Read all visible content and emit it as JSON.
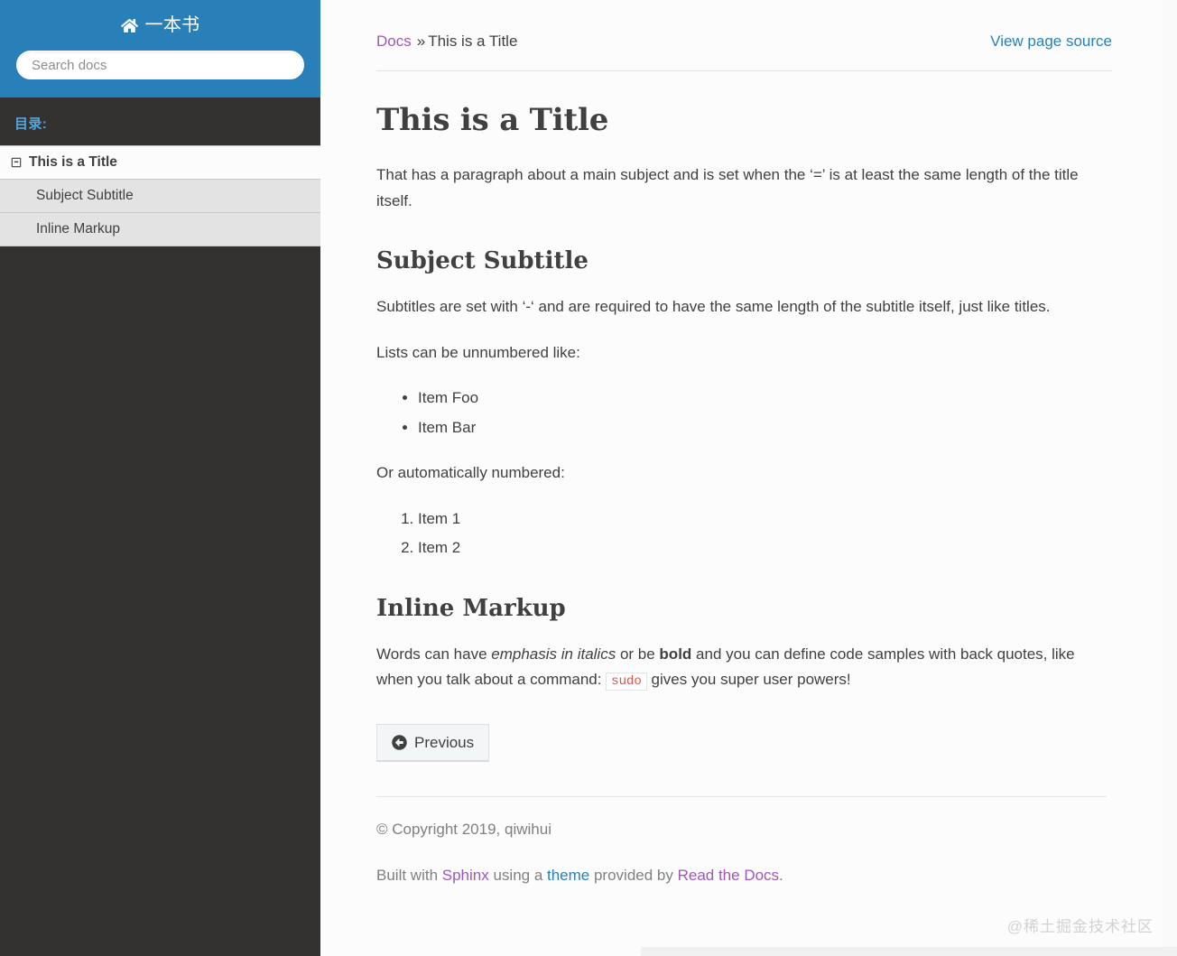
{
  "sidebar": {
    "brand": {
      "icon": "home-icon",
      "label": "一本书"
    },
    "search": {
      "placeholder": "Search docs",
      "value": ""
    },
    "caption": "目录:",
    "current_item": {
      "label": "This is a Title",
      "toggle_icon": "minus-square-icon"
    },
    "sub_items": [
      {
        "label": "Subject Subtitle"
      },
      {
        "label": "Inline Markup"
      }
    ],
    "colors": {
      "header_bg": "#2980b9",
      "nav_bg": "#343131",
      "current_bg": "#fcfcfc",
      "sub_bg": "#e3e3e3",
      "caption_color": "#55a5d9"
    }
  },
  "breadcrumb": {
    "root_label": "Docs",
    "separator": "»",
    "current_label": "This is a Title",
    "view_source_label": "View page source"
  },
  "document": {
    "h1": "This is a Title",
    "p_intro": "That has a paragraph about a main subject and is set when the ‘=’ is at least the same length of the title itself.",
    "h2_subject": "Subject Subtitle",
    "p_subtitles": "Subtitles are set with ‘-‘ and are required to have the same length of the subtitle itself, just like titles.",
    "p_unnumbered_intro": "Lists can be unnumbered like:",
    "bullet_items": [
      "Item Foo",
      "Item Bar"
    ],
    "p_numbered_intro": "Or automatically numbered:",
    "numbered_items": [
      "Item 1",
      "Item 2"
    ],
    "h2_inline": "Inline Markup",
    "inline_paragraph": {
      "part1": "Words can have ",
      "emphasis": "emphasis in italics",
      "part2": " or be ",
      "bold": "bold",
      "part3": " and you can define code samples with back quotes, like when you talk about a command: ",
      "code": "sudo",
      "part4": " gives you super user powers!"
    }
  },
  "nav_buttons": {
    "previous_label": "Previous",
    "previous_icon": "arrow-left-circle-icon"
  },
  "footer": {
    "copyright": "© Copyright 2019, qiwihui",
    "built_with_prefix": "Built with ",
    "sphinx_label": "Sphinx",
    "using_a": " using a ",
    "theme_label": "theme",
    "provided_by": " provided by ",
    "rtd_label": "Read the Docs",
    "period": "."
  },
  "watermark": "@稀土掘金技术社区"
}
